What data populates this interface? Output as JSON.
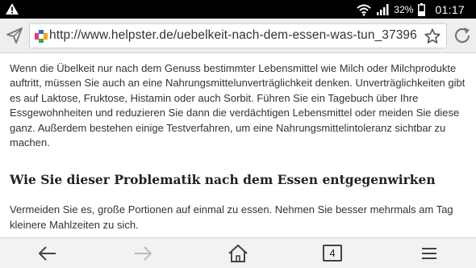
{
  "status_bar": {
    "battery_percent": "32%",
    "time": "01:17",
    "icons": [
      "warning-icon",
      "wifi-icon",
      "signal-icon",
      "battery-icon"
    ]
  },
  "toolbar": {
    "url": "http://www.helpster.de/uebelkeit-nach-dem-essen-was-tun_37396",
    "icons": [
      "send-icon",
      "favicon",
      "star-icon",
      "reload-icon"
    ]
  },
  "article": {
    "paragraph_1": "Wenn die Übelkeit nur nach dem Genuss bestimmter Lebensmittel wie Milch oder Milchprodukte auftritt, müssen Sie auch an eine Nahrungsmittelunverträglichkeit denken. Unverträglichkeiten gibt es auf Laktose, Fruktose, Histamin oder auch Sorbit. Führen Sie ein Tagebuch über Ihre Essgewohnheiten und reduzieren Sie dann die verdächtigen Lebensmittel oder meiden Sie diese ganz. Außerdem bestehen einige Testverfahren, um eine Nahrungsmittelintoleranz sichtbar zu machen.",
    "heading": "Wie Sie dieser Problematik nach dem Essen entgegenwirken",
    "paragraph_2": "Vermeiden Sie es, große Portionen auf einmal zu essen. Nehmen Sie besser mehrmals am Tag kleinere Mahlzeiten zu sich."
  },
  "bottom_nav": {
    "tab_count": "4",
    "icons": [
      "back-arrow-icon",
      "forward-arrow-icon",
      "home-icon",
      "tabs-icon",
      "menu-icon"
    ]
  },
  "colors": {
    "status_bar_bg": "#000000",
    "toolbar_bg": "#eeeeee",
    "text": "#333333"
  }
}
